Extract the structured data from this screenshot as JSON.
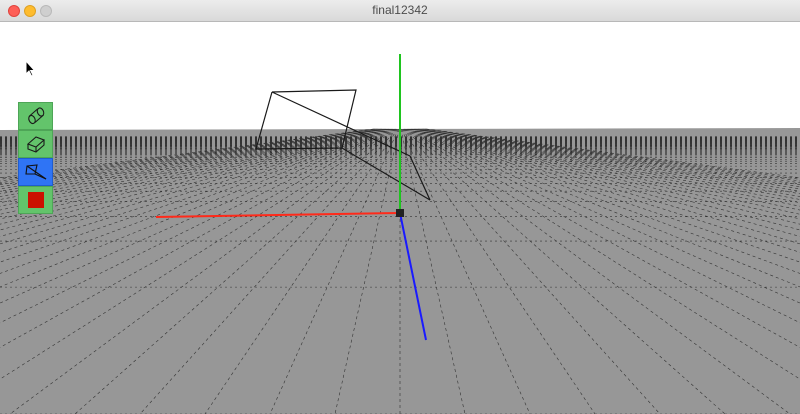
{
  "window": {
    "title": "final12342"
  },
  "toolbar": {
    "tools": [
      {
        "name": "cylinder-tool",
        "icon": "cylinder-icon",
        "state": "normal",
        "bg": "#63c46b"
      },
      {
        "name": "box-tool",
        "icon": "box-icon",
        "state": "normal",
        "bg": "#63c46b"
      },
      {
        "name": "plane-tool",
        "icon": "plane-icon",
        "state": "selected",
        "bg": "#2f74f5"
      },
      {
        "name": "stop-tool",
        "icon": "stop-square-icon",
        "state": "normal",
        "bg": "#63c46b"
      }
    ]
  },
  "scene": {
    "floor_color": "#979797",
    "sky_color": "#ffffff",
    "axis_colors": {
      "x": "#ff2a1a",
      "y": "#1fc41f",
      "z": "#1a1aff"
    }
  }
}
